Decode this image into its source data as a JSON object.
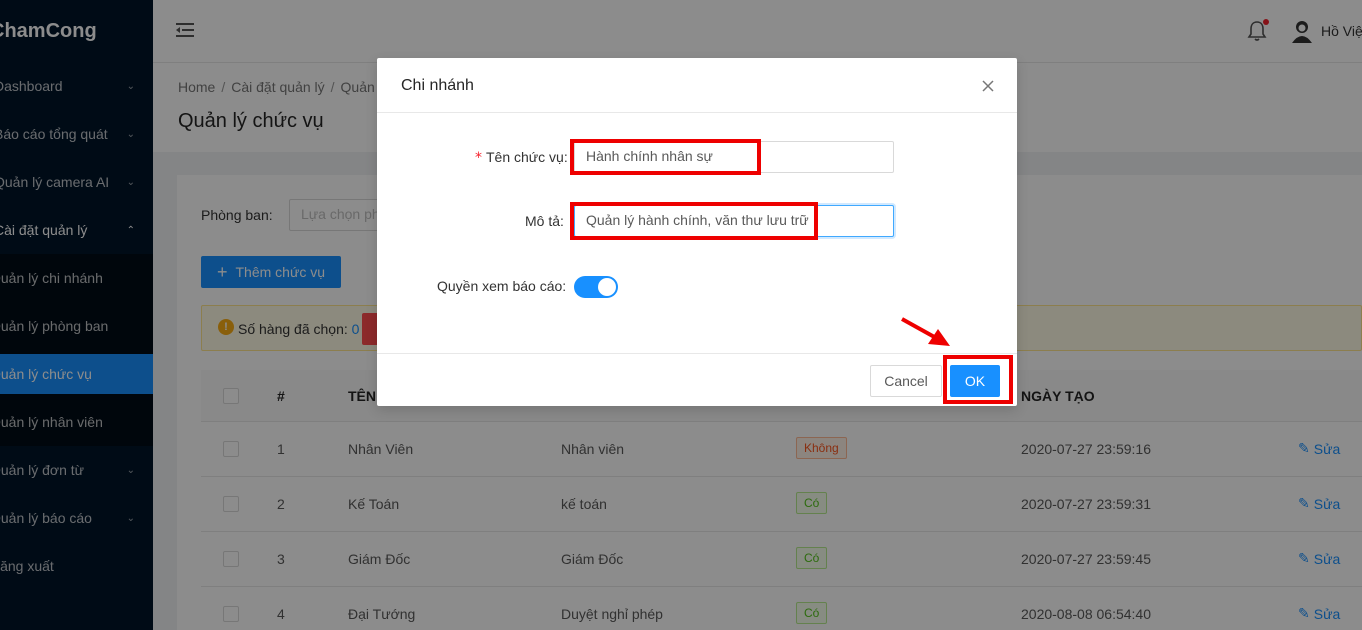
{
  "sidebar": {
    "logo": "ChamCong",
    "items": [
      {
        "label": "Dashboard",
        "chevron": "chevron-down"
      },
      {
        "label": "Báo cáo tổng quát",
        "chevron": "chevron-down"
      },
      {
        "label": "Quản lý camera AI",
        "chevron": "chevron-down"
      },
      {
        "label": "Cài đặt quản lý",
        "chevron": "chevron-up"
      },
      {
        "label": "Quản lý chi nhánh"
      },
      {
        "label": "Quản lý phòng ban"
      },
      {
        "label": "Quản lý chức vụ"
      },
      {
        "label": "Quản lý nhân viên"
      },
      {
        "label": "Quản lý đơn từ",
        "chevron": "chevron-down"
      },
      {
        "label": "Quản lý báo cáo",
        "chevron": "chevron-down"
      },
      {
        "label": "Đăng xuất"
      }
    ]
  },
  "header": {
    "user_name": "Hồ Việt"
  },
  "breadcrumb": [
    "Home",
    "Cài đặt quản lý",
    "Quản lý chức vụ"
  ],
  "page_title": "Quản lý chức vụ",
  "filter": {
    "label": "Phòng ban:",
    "placeholder": "Lựa chọn phòng ban"
  },
  "add_button": "Thêm chức vụ",
  "alert": {
    "text": "Số hàng đã chọn:",
    "count": "0"
  },
  "table": {
    "columns": [
      "#",
      "TÊN",
      "NGÀY TẠO"
    ],
    "rows": [
      {
        "index": "1",
        "name": "Nhân Viên",
        "desc": "Nhân viên",
        "report": "Không",
        "report_yes": false,
        "created": "2020-07-27 23:59:16",
        "edit": "Sửa"
      },
      {
        "index": "2",
        "name": "Kế Toán",
        "desc": "kế toán",
        "report": "Có",
        "report_yes": true,
        "created": "2020-07-27 23:59:31",
        "edit": "Sửa"
      },
      {
        "index": "3",
        "name": "Giám Đốc",
        "desc": "Giám Đốc",
        "report": "Có",
        "report_yes": true,
        "created": "2020-07-27 23:59:45",
        "edit": "Sửa"
      },
      {
        "index": "4",
        "name": "Đại Tướng",
        "desc": "Duyệt nghỉ phép",
        "report": "Có",
        "report_yes": true,
        "created": "2020-08-08 06:54:40",
        "edit": "Sửa"
      }
    ]
  },
  "modal": {
    "title": "Chi nhánh",
    "name_label": "Tên chức vụ:",
    "name_value": "Hành chính nhân sự",
    "desc_label": "Mô tả:",
    "desc_value": "Quản lý hành chính, văn thư lưu trữ",
    "report_label": "Quyền xem báo cáo:",
    "report_enabled": true,
    "cancel": "Cancel",
    "ok": "OK"
  },
  "colors": {
    "primary": "#1890ff",
    "sidebar": "#001529",
    "annotation": "#e00000"
  }
}
